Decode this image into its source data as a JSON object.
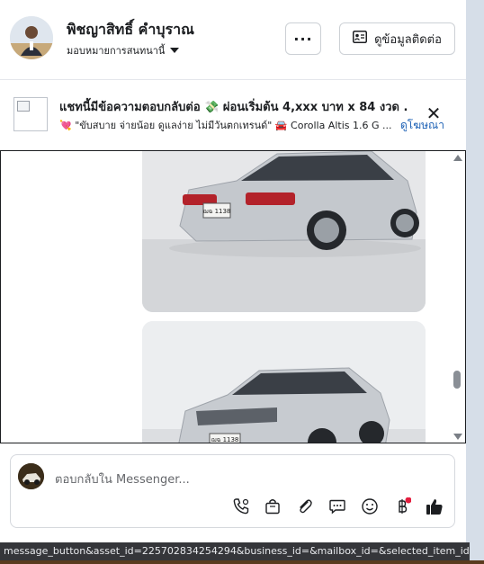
{
  "header": {
    "name": "พิชญาสิทธิ์ คำบุราณ",
    "assign_label": "มอบหมายการสนทนานี้",
    "more_label": "···",
    "contact_label": "ดูข้อมูลติดต่อ"
  },
  "ad": {
    "title": "แชทนี้มีข้อความตอบกลับต่อ 💸 ผ่อนเริ่มต้น 4,xxx บาท x 84 งวด .",
    "subtitle": "💘 \"ขับสบาย จ่ายน้อย ดูแลง่าย ไม่มีวันตกเทรนด์\" 🚘 Corolla Altis 1.6 G ...",
    "link_label": "ดูโฆษณา",
    "close_label": "✕"
  },
  "chat": {
    "photo1_plate": "ฌฉ 1138",
    "photo2_plate": "ฌฉ 1138"
  },
  "composer": {
    "placeholder": "ตอบกลับใน Messenger..."
  },
  "status_bar": {
    "text": "message_button&asset_id=225702834254294&business_id=&mailbox_id=&selected_item_id=1..."
  },
  "colors": {
    "accent": "#1a5fb4",
    "border": "#ccd0d5",
    "status_bg": "#35363a",
    "notification_dot": "#e41e3f"
  },
  "icons": [
    "contact-card-icon",
    "phone-icon",
    "shopping-bag-icon",
    "paperclip-icon",
    "chat-bubble-icon",
    "emoji-icon",
    "baht-icon",
    "thumbs-up-icon",
    "close-icon"
  ]
}
